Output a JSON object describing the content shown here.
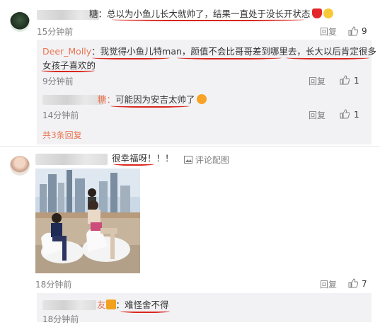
{
  "comments": [
    {
      "suffix": "糖：",
      "text": "总以为小鱼儿长大就帅了，结果一直处于没长开状态",
      "time": "15分钟前",
      "reply_label": "回复",
      "likes": "9",
      "replies": [
        {
          "nick": "Deer_Molly",
          "text": "：我觉得小鱼儿特man，颜值不会比哥哥差到哪里去，长大以后肯定很多女孩子喜欢的",
          "line1": "：我觉得小鱼儿特man，颜值不会比哥哥差到哪里去，长大以后肯定很多",
          "line2": "女孩子喜欢的",
          "time": "9分钟前",
          "reply_label": "回复",
          "likes": "1"
        },
        {
          "suffix": "糖：",
          "text": "可能因为安吉太帅了",
          "time": "14分钟前",
          "reply_label": "回复",
          "likes": "1"
        }
      ],
      "total_replies": "共3条回复"
    },
    {
      "text": "很幸福呀！！！",
      "comment_image_label": "评论配图",
      "time": "18分钟前",
      "reply_label": "回复",
      "likes": "7",
      "replies": [
        {
          "suffix": "友",
          "text": "：难怪舍不得",
          "time": "18分钟前"
        }
      ]
    }
  ],
  "colors": {
    "accent": "#eb7350",
    "underline": "#d9261c",
    "panel": "#f2f2f5"
  },
  "icons": [
    "heart-emoji",
    "laugh-emoji",
    "thumb-up-icon",
    "image-icon"
  ]
}
